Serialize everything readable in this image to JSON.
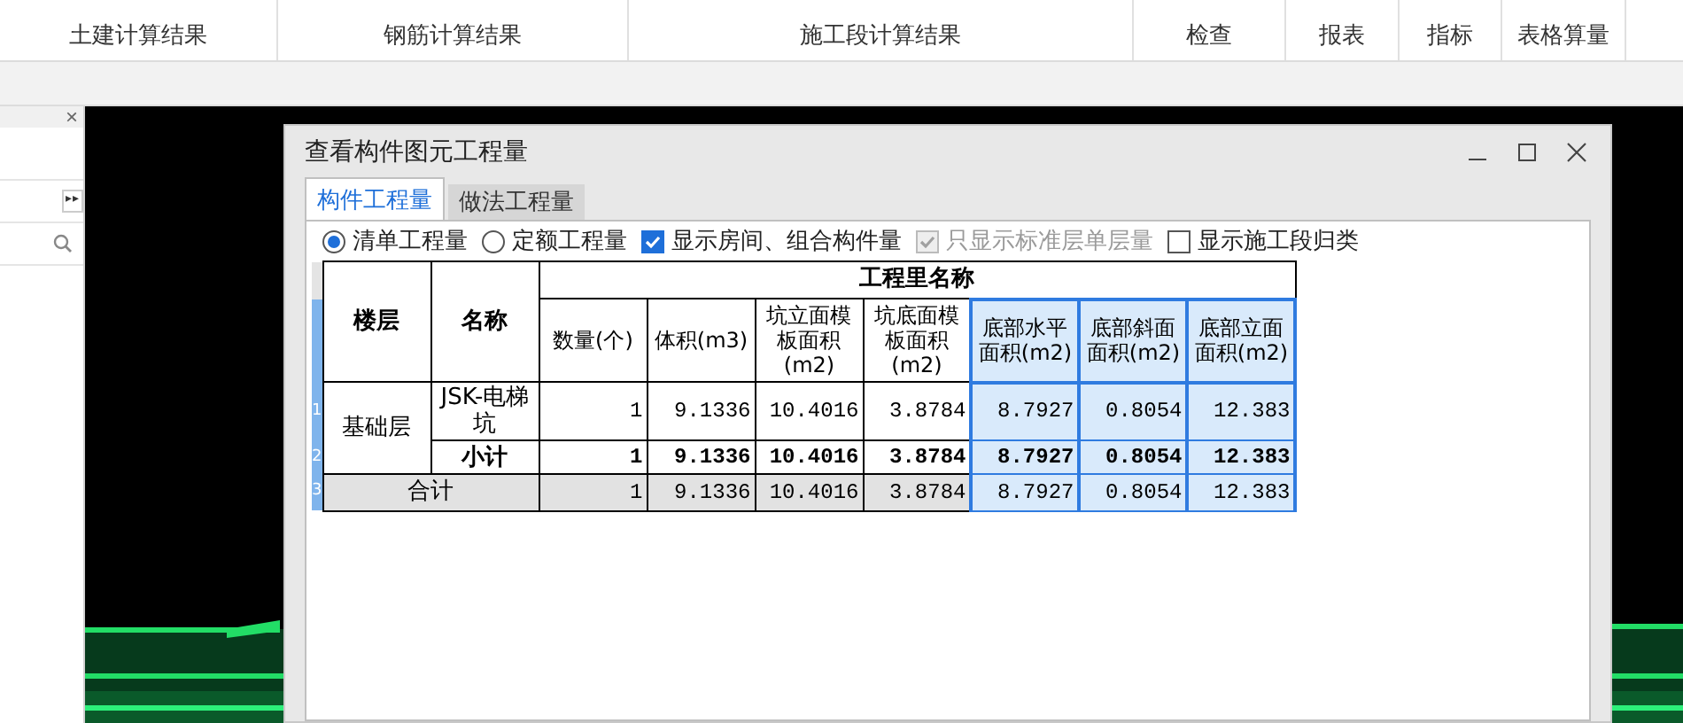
{
  "ribbon": {
    "groups": [
      {
        "label": "土建计算结果"
      },
      {
        "label": "钢筋计算结果"
      },
      {
        "label": "施工段计算结果"
      },
      {
        "label": "检查"
      },
      {
        "label": "报表"
      },
      {
        "label": "指标"
      },
      {
        "label": "表格算量"
      }
    ]
  },
  "left_panel": {
    "close": "×",
    "expand": "▸▸"
  },
  "dialog": {
    "title": "查看构件图元工程量",
    "tabs": [
      {
        "label": "构件工程量",
        "selected": true
      },
      {
        "label": "做法工程量",
        "selected": false
      }
    ],
    "options": [
      {
        "kind": "radio",
        "label": "清单工程量",
        "checked": true,
        "disabled": false
      },
      {
        "kind": "radio",
        "label": "定额工程量",
        "checked": false,
        "disabled": false
      },
      {
        "kind": "checkbox",
        "label": "显示房间、组合构件量",
        "checked": true,
        "disabled": false
      },
      {
        "kind": "checkbox",
        "label": "只显示标准层单层量",
        "checked": true,
        "disabled": true
      },
      {
        "kind": "checkbox",
        "label": "显示施工段归类",
        "checked": false,
        "disabled": false
      }
    ],
    "table": {
      "group_header": "工程里名称",
      "columns": [
        {
          "label": "楼层",
          "selected": false
        },
        {
          "label": "名称",
          "selected": false
        },
        {
          "label": "数量(个)",
          "selected": false
        },
        {
          "label": "体积(m3)",
          "selected": false
        },
        {
          "label": "坑立面模板面积(m2)",
          "selected": false
        },
        {
          "label": "坑底面模板面积(m2)",
          "selected": false
        },
        {
          "label": "底部水平面积(m2)",
          "selected": true
        },
        {
          "label": "底部斜面面积(m2)",
          "selected": true
        },
        {
          "label": "底部立面面积(m2)",
          "selected": true
        }
      ],
      "rows": [
        {
          "kind": "item",
          "number": "1",
          "floor": "基础层",
          "name": "JSK-电梯坑",
          "values": [
            "1",
            "9.1336",
            "10.4016",
            "3.8784",
            "8.7927",
            "0.8054",
            "12.383"
          ]
        },
        {
          "kind": "subtotal",
          "number": "2",
          "name": "小计",
          "values": [
            "1",
            "9.1336",
            "10.4016",
            "3.8784",
            "8.7927",
            "0.8054",
            "12.383"
          ]
        },
        {
          "kind": "total",
          "number": "3",
          "name": "合计",
          "values": [
            "1",
            "9.1336",
            "10.4016",
            "3.8784",
            "8.7927",
            "0.8054",
            "12.383"
          ]
        }
      ]
    }
  }
}
